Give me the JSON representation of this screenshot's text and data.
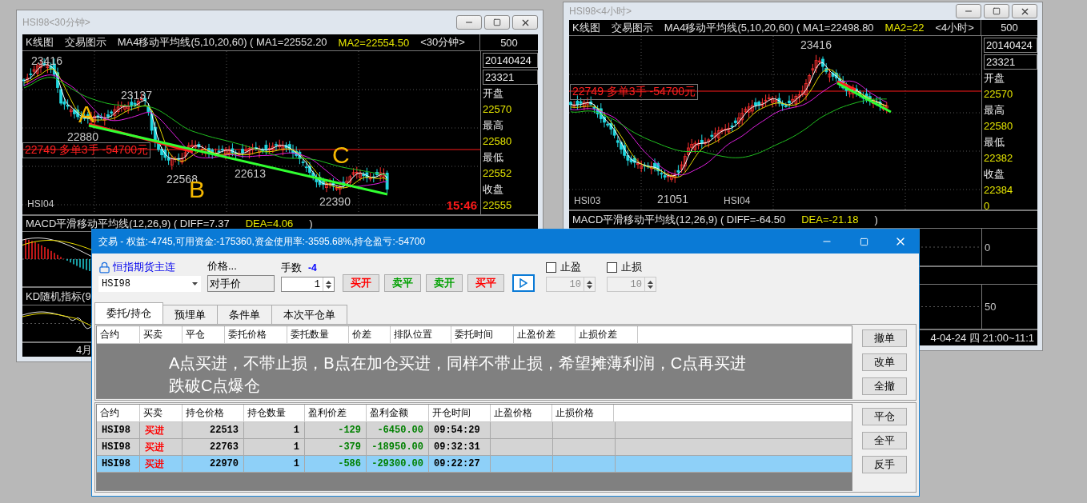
{
  "chart_windows": [
    {
      "title": "HSI98<30分钟>",
      "header": {
        "items": [
          "K线图",
          "交易图示"
        ],
        "indicator": "MA4移动平均线(5,10,20,60) ( MA1=22552.20",
        "ma2": "MA2=22554.50",
        "period": "<30分钟>",
        "scale": "500"
      },
      "annotations": [
        {
          "kind": "price",
          "text": "23416"
        },
        {
          "kind": "price",
          "text": "23137"
        },
        {
          "kind": "price",
          "text": "22880"
        },
        {
          "kind": "price",
          "text": "22568"
        },
        {
          "kind": "price",
          "text": "22613"
        },
        {
          "kind": "price",
          "text": "22390"
        },
        {
          "kind": "point",
          "text": "A"
        },
        {
          "kind": "point",
          "text": "B"
        },
        {
          "kind": "point",
          "text": "C"
        },
        {
          "kind": "position",
          "text": "22749 多单3手 -54700元"
        },
        {
          "kind": "contract",
          "text": "HSI04"
        },
        {
          "kind": "time",
          "text": "15:46"
        }
      ],
      "sidebar": {
        "date": "20140424",
        "last": "23321",
        "stats": [
          {
            "label": "开盘",
            "value": "22570"
          },
          {
            "label": "最高",
            "value": "22580"
          },
          {
            "label": "最低",
            "value": "22552"
          },
          {
            "label": "收盘",
            "value": "22555"
          }
        ]
      },
      "panes": [
        {
          "kind": "macd",
          "title": "MACD平滑移动平均线(12,26,9) ( DIFF=7.37",
          "dea": "DEA=4.06",
          "close": ")"
        },
        {
          "kind": "kd",
          "title": "KD随机指标(9"
        }
      ],
      "axis_label": "4月"
    },
    {
      "title": "HSI98<4小时>",
      "header": {
        "items": [
          "K线图",
          "交易图示"
        ],
        "indicator": "MA4移动平均线(5,10,20,60) ( MA1=22498.80",
        "ma2": "MA2=22",
        "period": "<4小时>",
        "scale": "500"
      },
      "annotations": [
        {
          "kind": "price",
          "text": "23416"
        },
        {
          "kind": "price",
          "text": "21051"
        },
        {
          "kind": "position",
          "text": "22749 多单3手 -54700元"
        },
        {
          "kind": "contract",
          "text": "HSI03"
        },
        {
          "kind": "contract",
          "text": "HSI04"
        }
      ],
      "sidebar": {
        "date": "20140424",
        "last": "23321",
        "stats": [
          {
            "label": "开盘",
            "value": "22570"
          },
          {
            "label": "最高",
            "value": "22580"
          },
          {
            "label": "最低",
            "value": "22382"
          },
          {
            "label": "收盘",
            "value": "22384"
          }
        ],
        "footer": "0"
      },
      "panes": [
        {
          "kind": "macd",
          "title": "MACD平滑移动平均线(12,26,9) ( DIFF=-64.50",
          "dea": "DEA=-21.18",
          "close": ")",
          "axis": "0"
        },
        {
          "kind": "kd",
          "axis": "50"
        }
      ],
      "axis_label": "4-04-24 四 21:00~11:1"
    }
  ],
  "trade_dialog": {
    "title": "交易 - 权益:-4745,可用资金:-175360,资金使用率:-3595.68%,持仓盈亏:-54700",
    "contract_link": "恒指期货主连",
    "contract": "HSI98",
    "price_label": "价格...",
    "price_type": "对手价",
    "qty_label": "手数",
    "qty_hint": "-4",
    "qty": "1",
    "actions": [
      {
        "label": "买开",
        "kind": "buy"
      },
      {
        "label": "卖平",
        "kind": "sell"
      },
      {
        "label": "卖开",
        "kind": "sell"
      },
      {
        "label": "买平",
        "kind": "buy"
      }
    ],
    "stops": [
      {
        "label": "止盈",
        "checked": false,
        "value": "10",
        "disabled": true
      },
      {
        "label": "止损",
        "checked": false,
        "value": "10",
        "disabled": true
      }
    ],
    "tabs": [
      {
        "label": "委托/持仓",
        "selected": true
      },
      {
        "label": "预埋单",
        "selected": false
      },
      {
        "label": "条件单",
        "selected": false
      },
      {
        "label": "本次平仓单",
        "selected": false
      }
    ],
    "orders": {
      "columns": [
        "合约",
        "买卖",
        "平仓",
        "委托价格",
        "委托数量",
        "价差",
        "排队位置",
        "委托时间",
        "止盈价差",
        "止损价差"
      ],
      "note": [
        "A点买进，不带止损，B点在加仓买进，同样不带止损，希望摊薄利润，C点再买进",
        "跌破C点爆仓"
      ],
      "buttons": [
        "撤单",
        "改单",
        "全撤"
      ]
    },
    "positions": {
      "columns": [
        "合约",
        "买卖",
        "持仓价格",
        "持仓数量",
        "盈利价差",
        "盈利金额",
        "开仓时间",
        "止盈价格",
        "止损价格"
      ],
      "rows": [
        {
          "contract": "HSI98",
          "side": "买进",
          "price": "22513",
          "qty": "1",
          "diff": "-129",
          "amount": "-6450.00",
          "time": "09:54:29",
          "selected": false
        },
        {
          "contract": "HSI98",
          "side": "买进",
          "price": "22763",
          "qty": "1",
          "diff": "-379",
          "amount": "-18950.00",
          "time": "09:32:31",
          "selected": false
        },
        {
          "contract": "HSI98",
          "side": "买进",
          "price": "22970",
          "qty": "1",
          "diff": "-586",
          "amount": "-29300.00",
          "time": "09:22:27",
          "selected": true
        }
      ],
      "buttons": [
        "平仓",
        "全平",
        "反手"
      ]
    }
  }
}
